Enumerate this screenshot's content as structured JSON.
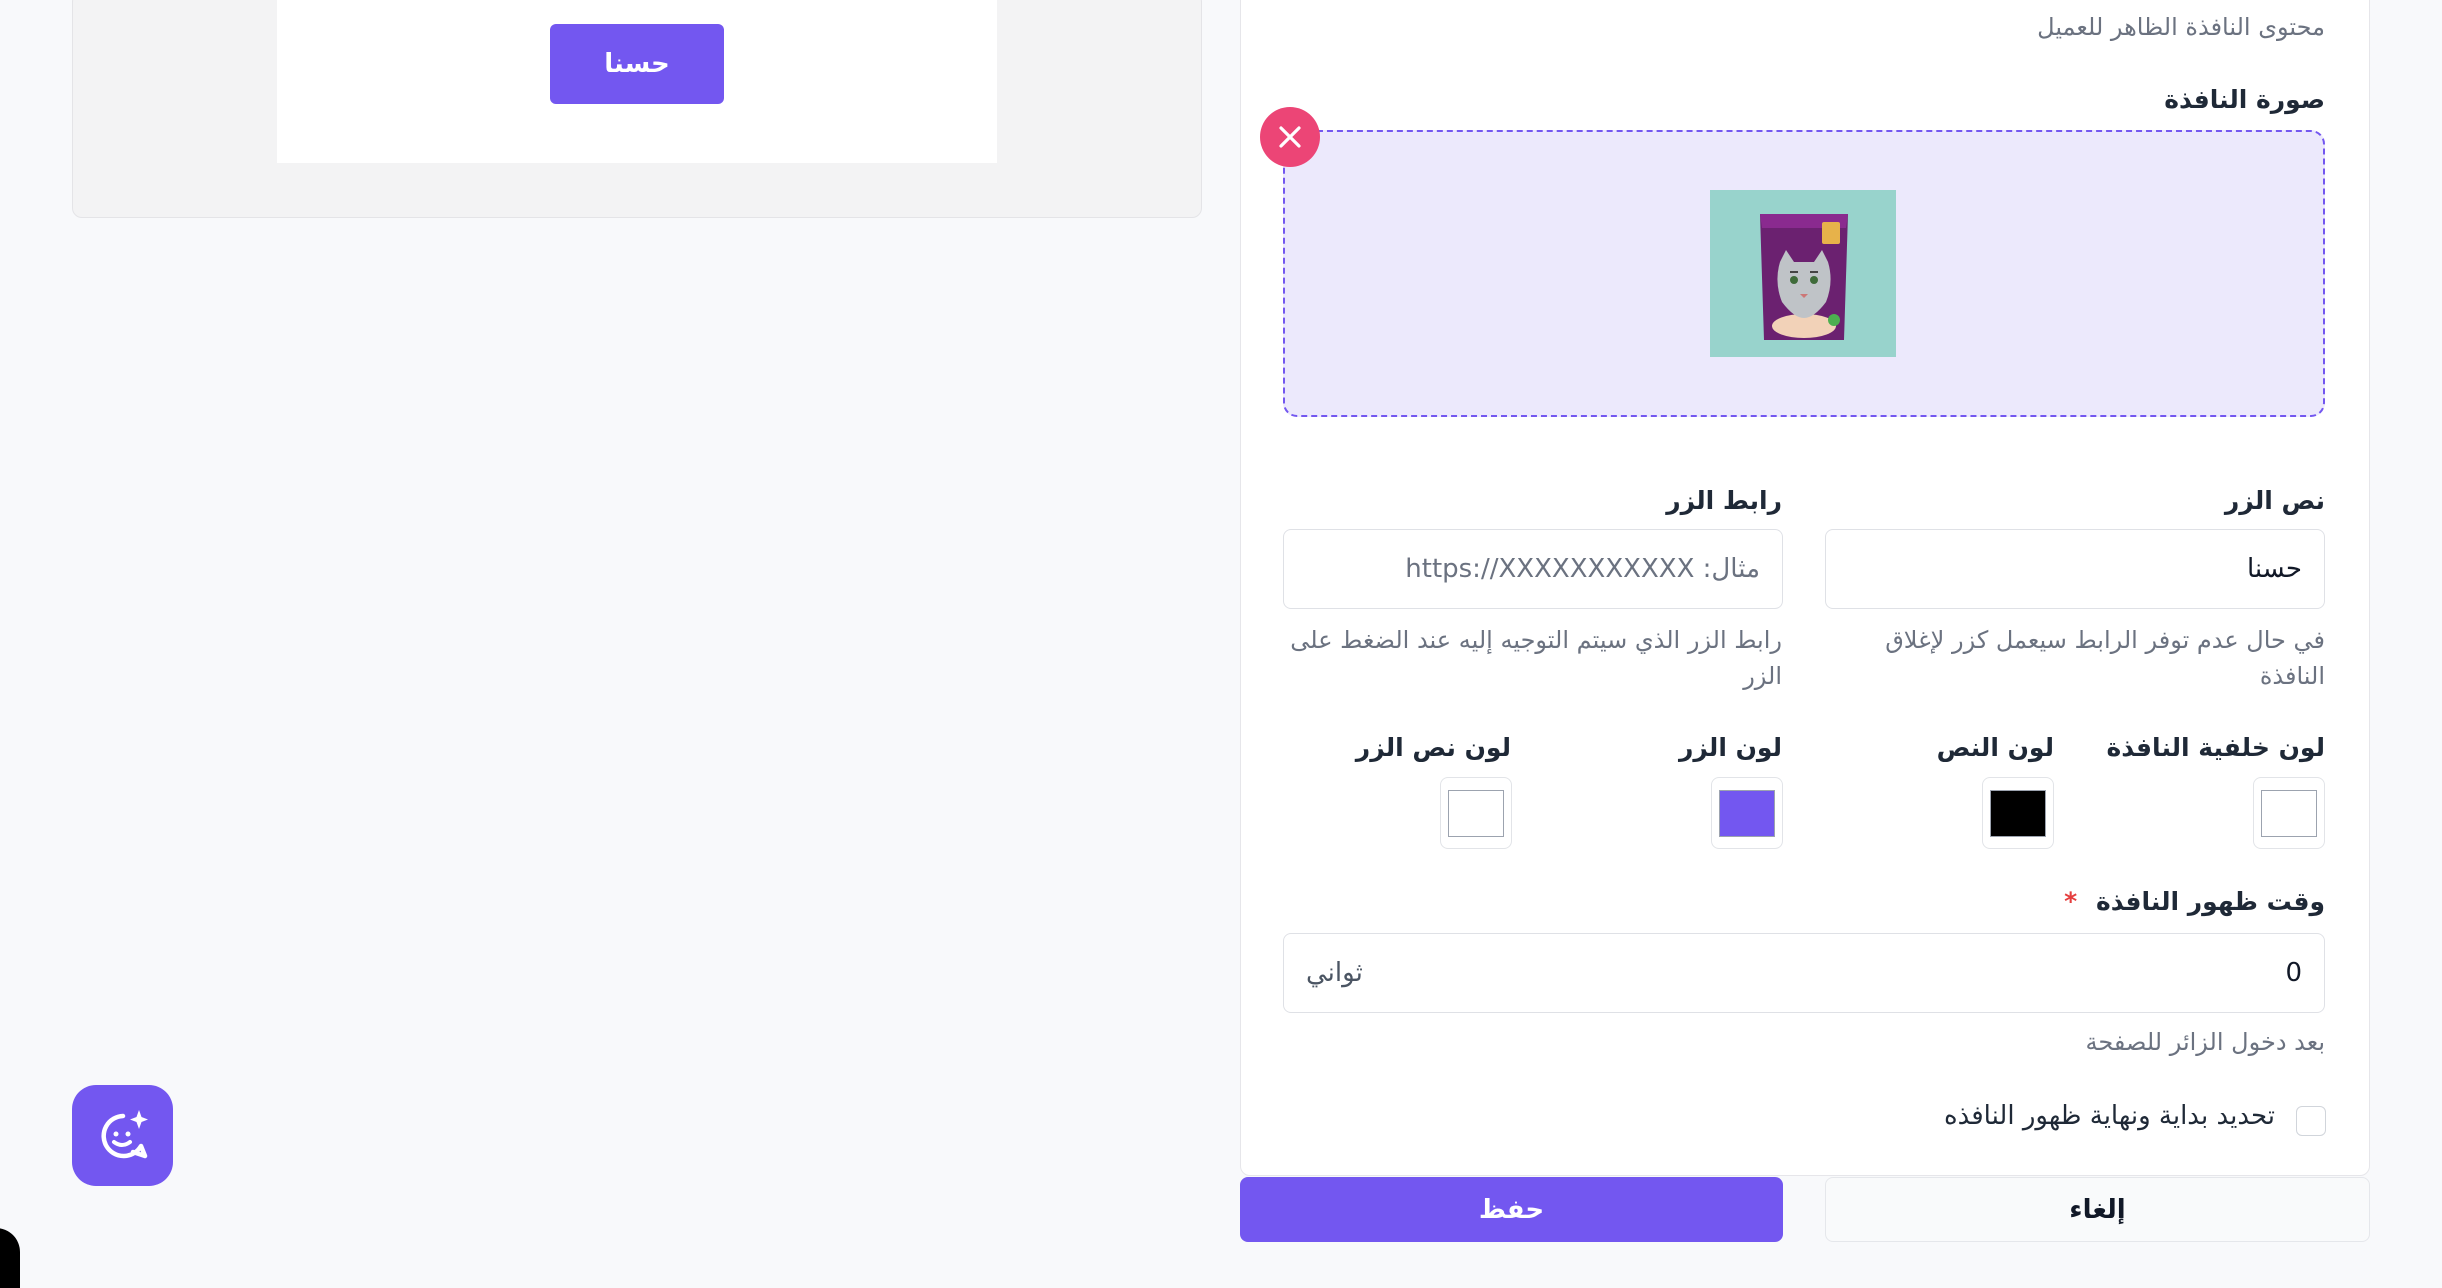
{
  "preview": {
    "button_label": "حسنا"
  },
  "form": {
    "content_hint": "محتوى النافذة الظاهر للعميل",
    "image_label": "صورة النافذة",
    "button_text_label": "نص الزر",
    "button_text_value": "حسنا",
    "button_text_help": "في حال عدم توفر الرابط سيعمل كزر لإغلاق النافذة",
    "button_link_label": "رابط الزر",
    "button_link_placeholder": "مثال: https://XXXXXXXXXXX",
    "button_link_help": "رابط الزر الذي سيتم التوجيه إليه عند الضغط على الزر",
    "colors": {
      "window_bg_label": "لون خلفية النافذة",
      "window_bg_color": "#ffffff",
      "text_label": "لون النص",
      "text_color": "#000000",
      "button_label": "لون الزر",
      "button_color": "#7357f0",
      "button_text_label": "لون نص الزر",
      "button_text_color": "#ffffff"
    },
    "delay_label": "وقت ظهور النافذة",
    "required_mark": "*",
    "delay_value": "0",
    "delay_unit": "ثواني",
    "delay_help": "بعد دخول الزائر للصفحة",
    "schedule_label": "تحديد بداية ونهاية ظهور النافذه",
    "schedule_checked": false
  },
  "actions": {
    "cancel_label": "إلغاء",
    "save_label": "حفظ"
  },
  "theme": {
    "accent": "#7357f0",
    "danger": "#ec4576"
  },
  "icons": {
    "remove": "close-icon",
    "chat": "chat-sparkle-icon"
  }
}
